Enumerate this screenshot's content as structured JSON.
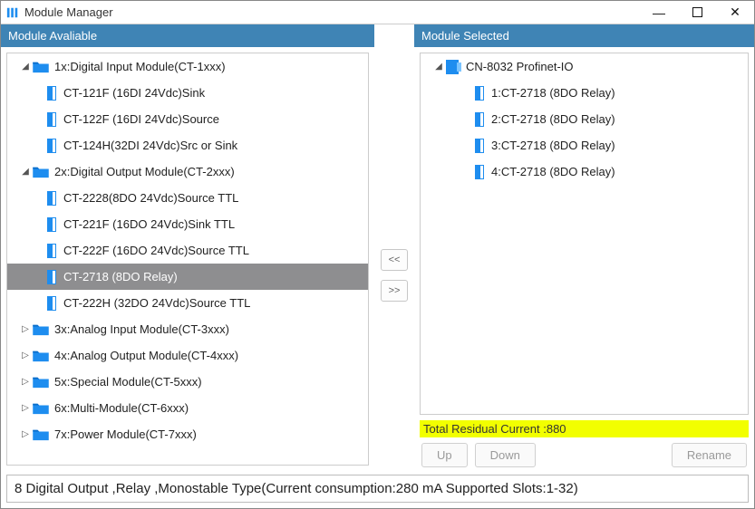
{
  "window": {
    "title": "Module Manager"
  },
  "left": {
    "header": "Module Avaliable"
  },
  "right": {
    "header": "Module Selected"
  },
  "tree": [
    {
      "type": "folder",
      "open": true,
      "label": "1x:Digital Input Module(CT-1xxx)"
    },
    {
      "type": "mod",
      "label": "CT-121F (16DI 24Vdc)Sink"
    },
    {
      "type": "mod",
      "label": "CT-122F (16DI 24Vdc)Source"
    },
    {
      "type": "mod",
      "label": "CT-124H(32DI 24Vdc)Src or Sink"
    },
    {
      "type": "folder",
      "open": true,
      "label": "2x:Digital Output Module(CT-2xxx)"
    },
    {
      "type": "mod",
      "label": "CT-2228(8DO 24Vdc)Source TTL"
    },
    {
      "type": "mod",
      "label": "CT-221F (16DO 24Vdc)Sink TTL"
    },
    {
      "type": "mod",
      "label": "CT-222F (16DO 24Vdc)Source TTL"
    },
    {
      "type": "mod",
      "label": "CT-2718 (8DO Relay)",
      "selected": true
    },
    {
      "type": "mod",
      "label": "CT-222H (32DO 24Vdc)Source TTL"
    },
    {
      "type": "folder",
      "open": false,
      "label": "3x:Analog Input Module(CT-3xxx)"
    },
    {
      "type": "folder",
      "open": false,
      "label": "4x:Analog Output Module(CT-4xxx)"
    },
    {
      "type": "folder",
      "open": false,
      "label": "5x:Special Module(CT-5xxx)"
    },
    {
      "type": "folder",
      "open": false,
      "label": "6x:Multi-Module(CT-6xxx)"
    },
    {
      "type": "folder",
      "open": false,
      "label": "7x:Power Module(CT-7xxx)"
    }
  ],
  "selected": {
    "root": "CN-8032 Profinet-IO",
    "items": [
      "1:CT-2718 (8DO Relay)",
      "2:CT-2718 (8DO Relay)",
      "3:CT-2718 (8DO Relay)",
      "4:CT-2718 (8DO Relay)"
    ]
  },
  "transfer": {
    "left": "<<",
    "right": ">>"
  },
  "residual": "Total Residual Current :880",
  "buttons": {
    "up": "Up",
    "down": "Down",
    "rename": "Rename"
  },
  "description": "8 Digital Output ,Relay ,Monostable Type(Current consumption:280 mA  Supported Slots:1-32)"
}
